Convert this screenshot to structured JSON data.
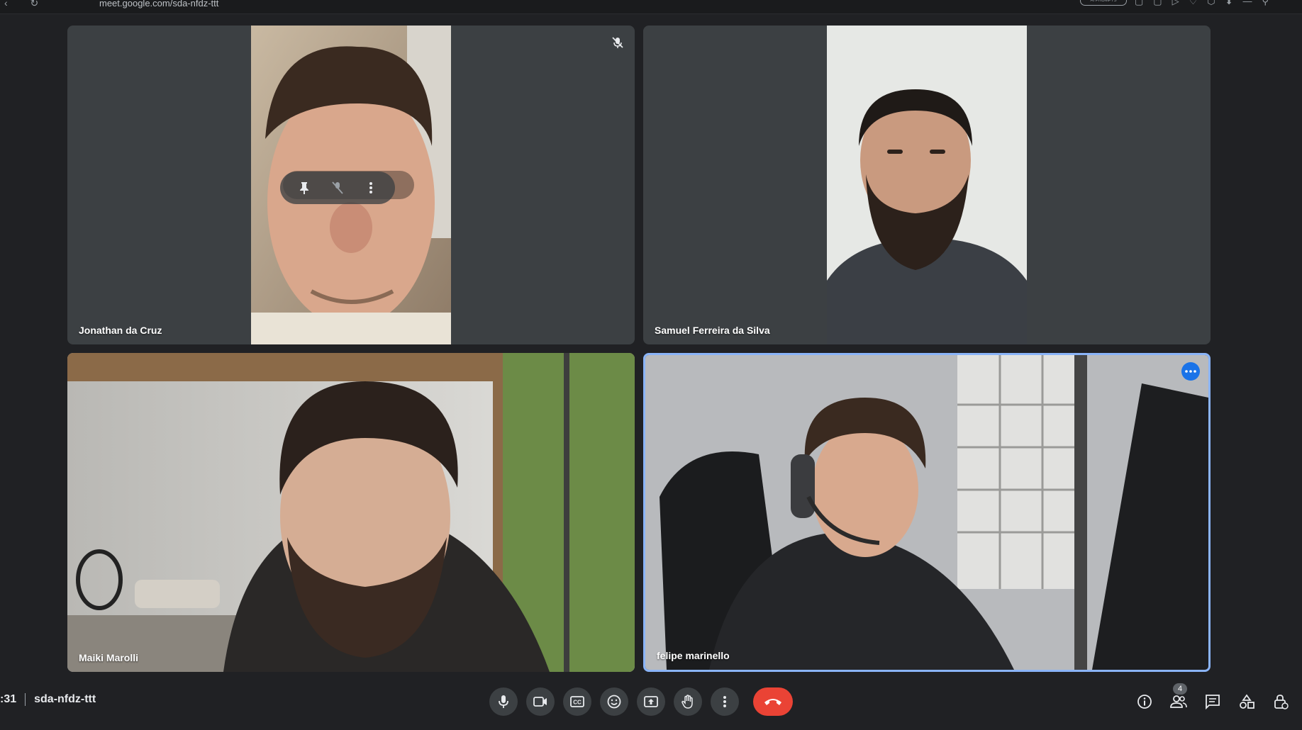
{
  "browser": {
    "url": "meet.google.com/sda-nfdz-ttt",
    "extension_pill": "AI PROMPTS"
  },
  "meeting": {
    "time": ":31",
    "code": "sda-nfdz-ttt"
  },
  "participants": [
    {
      "name": "Jonathan da Cruz",
      "muted": true
    },
    {
      "name": "Samuel Ferreira da Silva",
      "muted": false
    },
    {
      "name": "Maiki Marolli",
      "muted": false
    },
    {
      "name": "felipe marinello",
      "muted": false,
      "active_speaker": true
    }
  ],
  "toolbar": {
    "people_count": "4",
    "icons": [
      "microphone-icon",
      "camera-icon",
      "captions-icon",
      "emoji-icon",
      "present-icon",
      "raise-hand-icon",
      "more-options-icon",
      "end-call-icon"
    ],
    "right_icons": [
      "info-icon",
      "people-icon",
      "chat-icon",
      "activities-icon",
      "host-controls-icon"
    ]
  },
  "colors": {
    "background": "#202124",
    "tile": "#3c4043",
    "active_border": "#8ab4f8",
    "end_call": "#ea4335",
    "accent": "#1a73e8"
  }
}
